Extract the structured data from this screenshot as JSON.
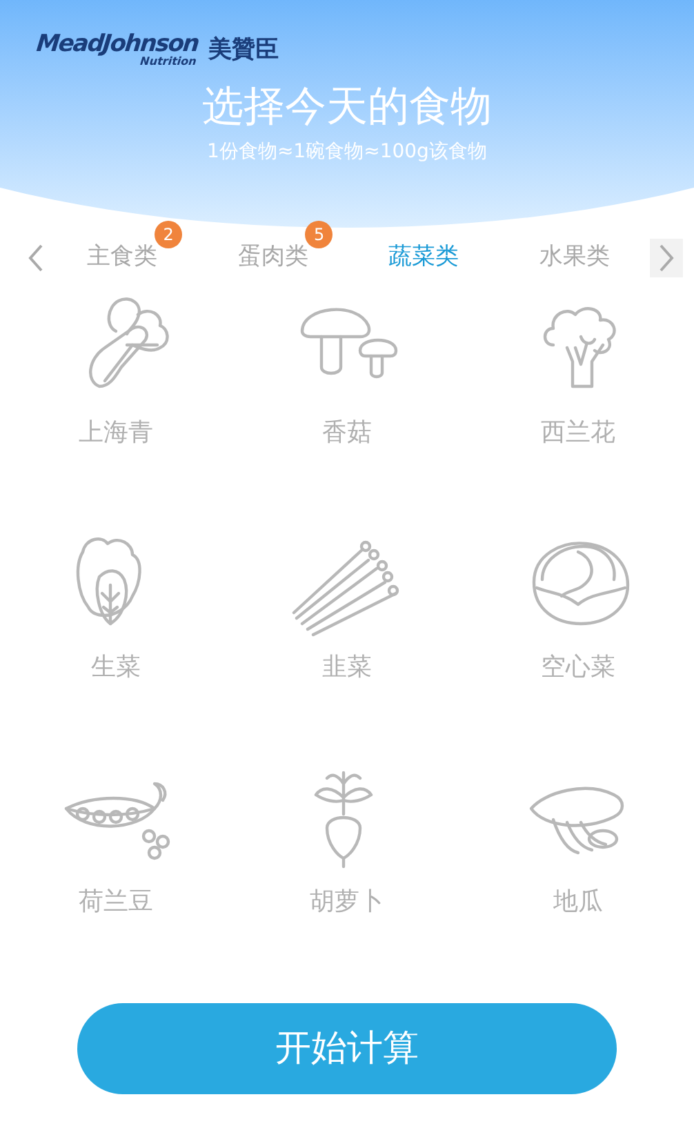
{
  "brand": {
    "logo_main": "MeadJohnson",
    "logo_sub": "Nutrition",
    "name": "美贊臣"
  },
  "title": "选择今天的食物",
  "subtitle": "1份食物≈1碗食物≈100g该食物",
  "tabs": [
    {
      "label": "主食类",
      "selected": false,
      "badge": "2"
    },
    {
      "label": "蛋肉类",
      "selected": false,
      "badge": "5"
    },
    {
      "label": "蔬菜类",
      "selected": true
    },
    {
      "label": "水果类",
      "selected": false
    }
  ],
  "foods": [
    {
      "label": "上海青"
    },
    {
      "label": "香菇"
    },
    {
      "label": "西兰花"
    },
    {
      "label": "生菜"
    },
    {
      "label": "韭菜"
    },
    {
      "label": "空心菜"
    },
    {
      "label": "荷兰豆"
    },
    {
      "label": "胡萝卜"
    },
    {
      "label": "地瓜"
    }
  ],
  "button": "开始计算"
}
